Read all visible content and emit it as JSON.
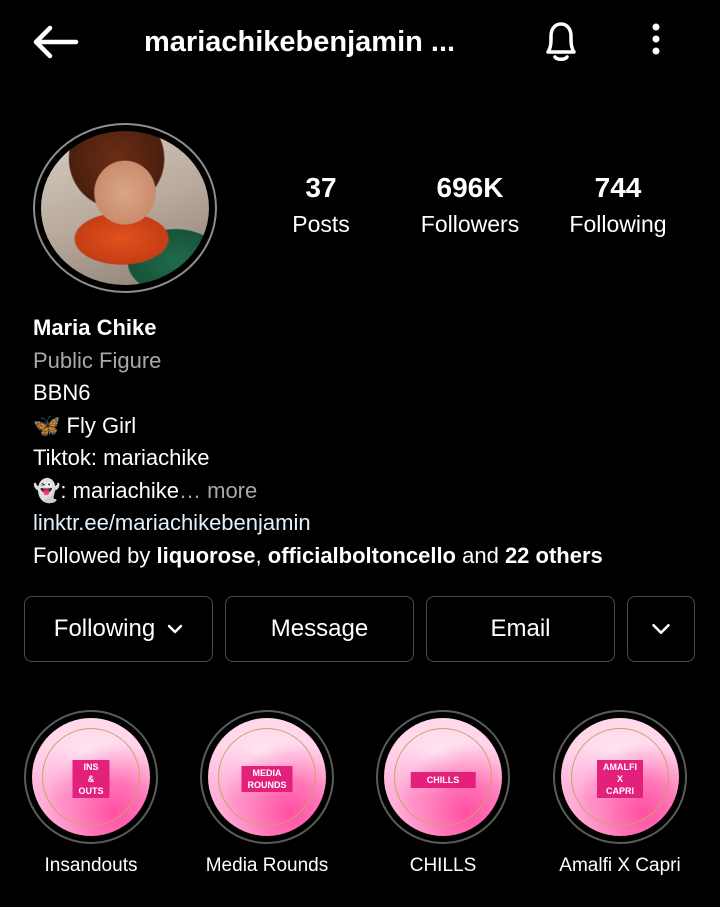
{
  "header": {
    "username": "mariachikebenjamin ..."
  },
  "stats": [
    {
      "value": "37",
      "label": "Posts"
    },
    {
      "value": "696K",
      "label": "Followers"
    },
    {
      "value": "744",
      "label": "Following"
    }
  ],
  "bio": {
    "name": "Maria Chike",
    "category": "Public Figure",
    "line1": "BBN6",
    "line2_emoji": "🦋",
    "line2_text": "Fly Girl",
    "line3": "Tiktok: mariachike",
    "line4_emoji": "👻",
    "line4_text": ": mariachike",
    "line4_more": "… more",
    "link": "linktr.ee/mariachikebenjamin",
    "followed_by_prefix": "Followed by ",
    "followed_user1": "liquorose",
    "followed_sep": ", ",
    "followed_user2": "officialboltoncello",
    "followed_and": " and ",
    "followed_others": "22 others"
  },
  "buttons": {
    "following": "Following",
    "message": "Message",
    "email": "Email"
  },
  "highlights": [
    {
      "label": "Insandouts",
      "tag_lines": [
        "INS",
        "&",
        "OUTS"
      ]
    },
    {
      "label": "Media Rounds",
      "tag_lines": [
        "MEDIA",
        "ROUNDS"
      ]
    },
    {
      "label": "CHILLS",
      "tag_lines": [
        "CHILLS"
      ]
    },
    {
      "label": "Amalfi X Capri",
      "tag_lines": [
        "AMALFI",
        "X",
        "CAPRI"
      ]
    }
  ],
  "colors": {
    "background": "#000000",
    "text": "#ffffff",
    "secondary_text": "#a8a8a8",
    "link": "#e0f1ff",
    "highlight_tag": "#e3207c"
  },
  "icons": {
    "back": "arrow-left-icon",
    "notifications": "bell-icon",
    "options": "more-vertical-icon",
    "dropdown": "chevron-down-icon"
  }
}
